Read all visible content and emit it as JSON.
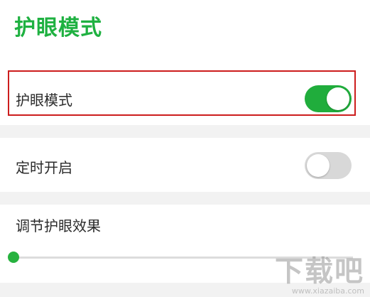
{
  "page": {
    "title": "护眼模式"
  },
  "settings": {
    "eye_protection": {
      "label": "护眼模式",
      "enabled": true
    },
    "scheduled_on": {
      "label": "定时开启",
      "enabled": false
    },
    "adjust_effect": {
      "label": "调节护眼效果",
      "level": 0.0
    }
  },
  "watermark": {
    "main": "下载吧",
    "sub": "www.xiazaiba.com"
  },
  "colors": {
    "accent": "#1fb141",
    "toggle_on": "#20ad3c",
    "toggle_off": "#d8d8d8",
    "highlight": "#cc1d1d",
    "section_gap": "#f2f2f2"
  }
}
